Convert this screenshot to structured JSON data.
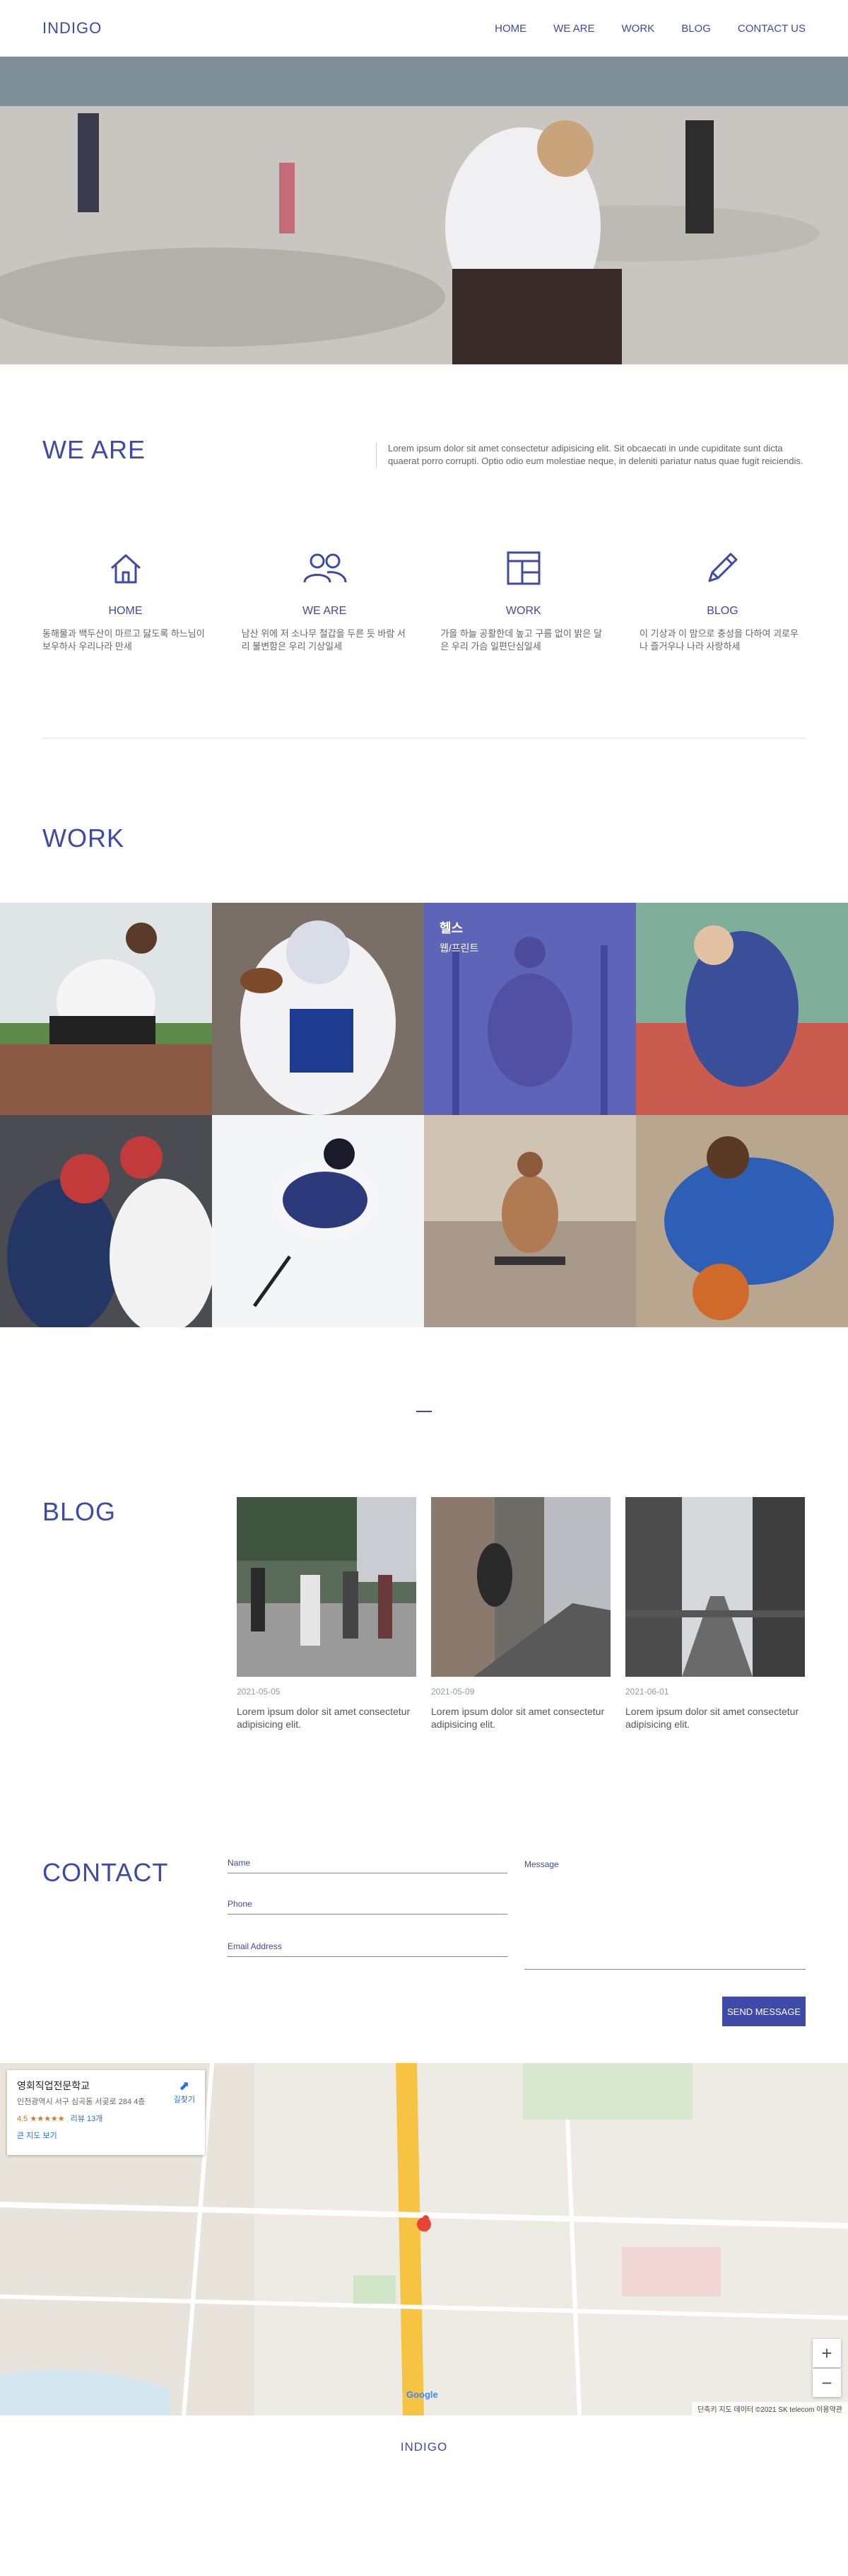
{
  "header": {
    "logo": "INDIGO",
    "nav": [
      "HOME",
      "WE ARE",
      "WORK",
      "BLOG",
      "CONTACT US"
    ]
  },
  "weare": {
    "title": "WE ARE",
    "description": "Lorem ipsum dolor sit amet consectetur adipisicing elit. Sit obcaecati in unde cupiditate sunt dicta quaerat porro corrupti. Optio odio eum molestiae neque, in deleniti pariatur natus quae fugit reiciendis.",
    "features": [
      {
        "icon": "home-icon",
        "title": "HOME",
        "desc": "동해물과 백두산이 마르고 닳도록 하느님이 보우하사 우리나라 만세"
      },
      {
        "icon": "people-icon",
        "title": "WE ARE",
        "desc": "남산 위에 저 소나무 철갑을 두른 듯 바람 서리 불변함은 우리 기상일세"
      },
      {
        "icon": "layout-icon",
        "title": "WORK",
        "desc": "가을 하늘 공활한데 높고 구름 없이 밝은 달은 우리 가슴 일편단심일세"
      },
      {
        "icon": "pencil-icon",
        "title": "BLOG",
        "desc": "이 기상과 이 맘으로 충성을 다하여 괴로우나 즐거우나 나라 사랑하세"
      }
    ]
  },
  "work": {
    "title": "WORK",
    "highlight": {
      "title": "헬스",
      "subtitle": "웹/프린트"
    }
  },
  "blog": {
    "title": "BLOG",
    "posts": [
      {
        "date": "2021-05-05",
        "text": "Lorem ipsum dolor sit amet consectetur adipisicing elit."
      },
      {
        "date": "2021-05-09",
        "text": "Lorem ipsum dolor sit amet consectetur adipisicing elit."
      },
      {
        "date": "2021-06-01",
        "text": "Lorem ipsum dolor sit amet consectetur adipisicing elit."
      }
    ]
  },
  "contact": {
    "title": "CONTACT",
    "name_label": "Name",
    "phone_label": "Phone",
    "email_label": "Email Address",
    "message_label": "Message",
    "send_label": "SEND MESSAGE"
  },
  "map": {
    "place_name": "영회직업전문학교",
    "address": "인천광역시 서구 심곡동 서곶로 284 4층",
    "rating": "4.5 ★★★★★",
    "reviews": "리뷰 13개",
    "directions": "길찾기",
    "bigger_map": "큰 지도 보기",
    "zoom_in": "+",
    "zoom_out": "−",
    "google": "Google",
    "footer": "단축키   지도 데이터 ©2021 SK telecom   이용약관"
  },
  "footer": {
    "logo": "INDIGO"
  },
  "colors": {
    "accent": "#3f4aa6",
    "overlay": "#4650c8"
  }
}
